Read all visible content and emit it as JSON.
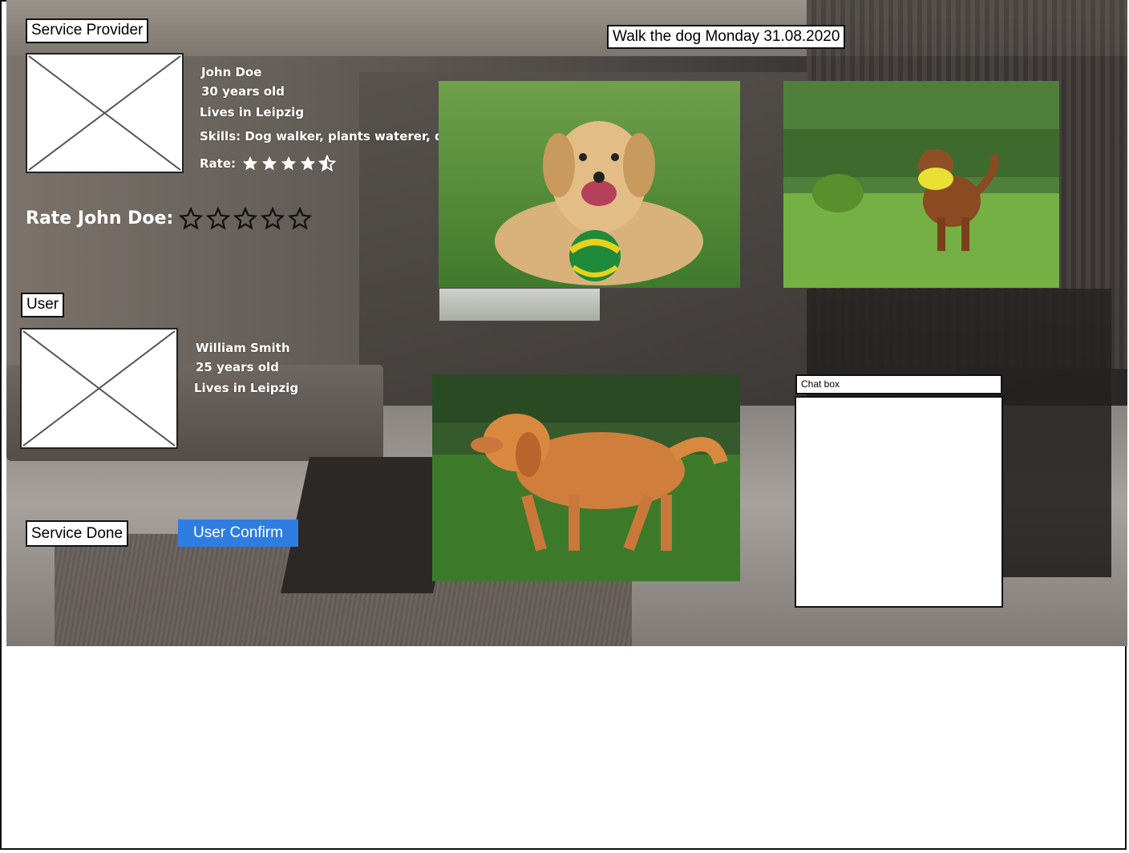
{
  "header": {
    "task_title": "Walk the dog Monday 31.08.2020"
  },
  "provider": {
    "section_label": "Service Provider",
    "name": "John Doe",
    "age": "30 years old",
    "location": "Lives in Leipzig",
    "skills": "Skills: Dog walker, plants waterer, driver",
    "rate_label": "Rate:",
    "rating": 4.5,
    "rating_max": 5
  },
  "rate_prompt": {
    "label": "Rate John Doe:",
    "stars_count": 5,
    "selected": 0
  },
  "user": {
    "section_label": "User",
    "name": "William Smith",
    "age": "25 years old",
    "location": "Lives in Leipzig"
  },
  "actions": {
    "service_done": "Service Done",
    "user_confirm": "User Confirm"
  },
  "chat": {
    "title": "Chat box",
    "messages": []
  },
  "colors": {
    "primary_button": "#2f7de1",
    "star_fill": "#ffffff",
    "star_outline": "#111111"
  }
}
